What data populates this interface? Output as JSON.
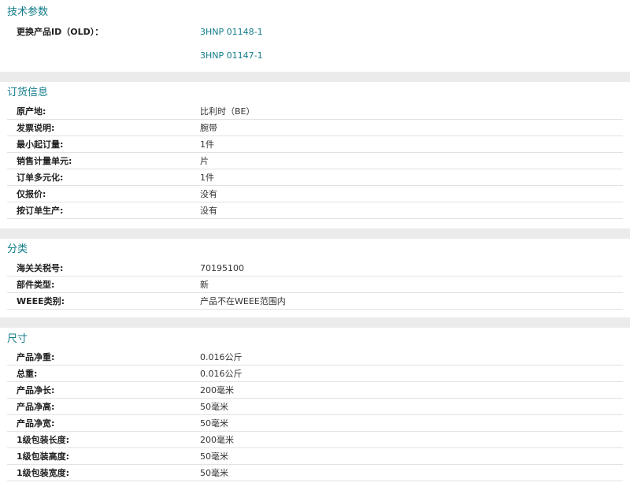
{
  "tech": {
    "title": "技术参数",
    "replace_label": "更换产品ID（OLD）：",
    "links": [
      "3HNP 01148-1",
      "3HNP 01147-1"
    ]
  },
  "ordering": {
    "title": "订货信息",
    "rows": [
      {
        "label": "原产地:",
        "value": "比利时（BE）"
      },
      {
        "label": "发票说明:",
        "value": "腕带"
      },
      {
        "label": "最小起订量:",
        "value": "1件"
      },
      {
        "label": "销售计量单元:",
        "value": "片"
      },
      {
        "label": "订单多元化:",
        "value": "1件"
      },
      {
        "label": "仅报价:",
        "value": "没有"
      },
      {
        "label": "按订单生产:",
        "value": "没有"
      }
    ]
  },
  "classification": {
    "title": "分类",
    "rows": [
      {
        "label": "海关关税号:",
        "value": "70195100"
      },
      {
        "label": "部件类型:",
        "value": "新"
      },
      {
        "label": "WEEE类别:",
        "value": "产品不在WEEE范围内"
      }
    ]
  },
  "dimensions": {
    "title": "尺寸",
    "rows": [
      {
        "label": "产品净重:",
        "value": "0.016公斤"
      },
      {
        "label": "总重:",
        "value": "0.016公斤"
      },
      {
        "label": "产品净长:",
        "value": "200毫米"
      },
      {
        "label": "产品净高:",
        "value": "50毫米"
      },
      {
        "label": "产品净宽:",
        "value": "50毫米"
      },
      {
        "label": "1级包装长度:",
        "value": "200毫米"
      },
      {
        "label": "1级包装高度:",
        "value": "50毫米"
      },
      {
        "label": "1级包装宽度:",
        "value": "50毫米"
      }
    ]
  },
  "colors": {
    "section_title": "#127c8a",
    "link": "#127c8a",
    "gap": "#ebebeb",
    "divider": "#e2e2e2"
  }
}
